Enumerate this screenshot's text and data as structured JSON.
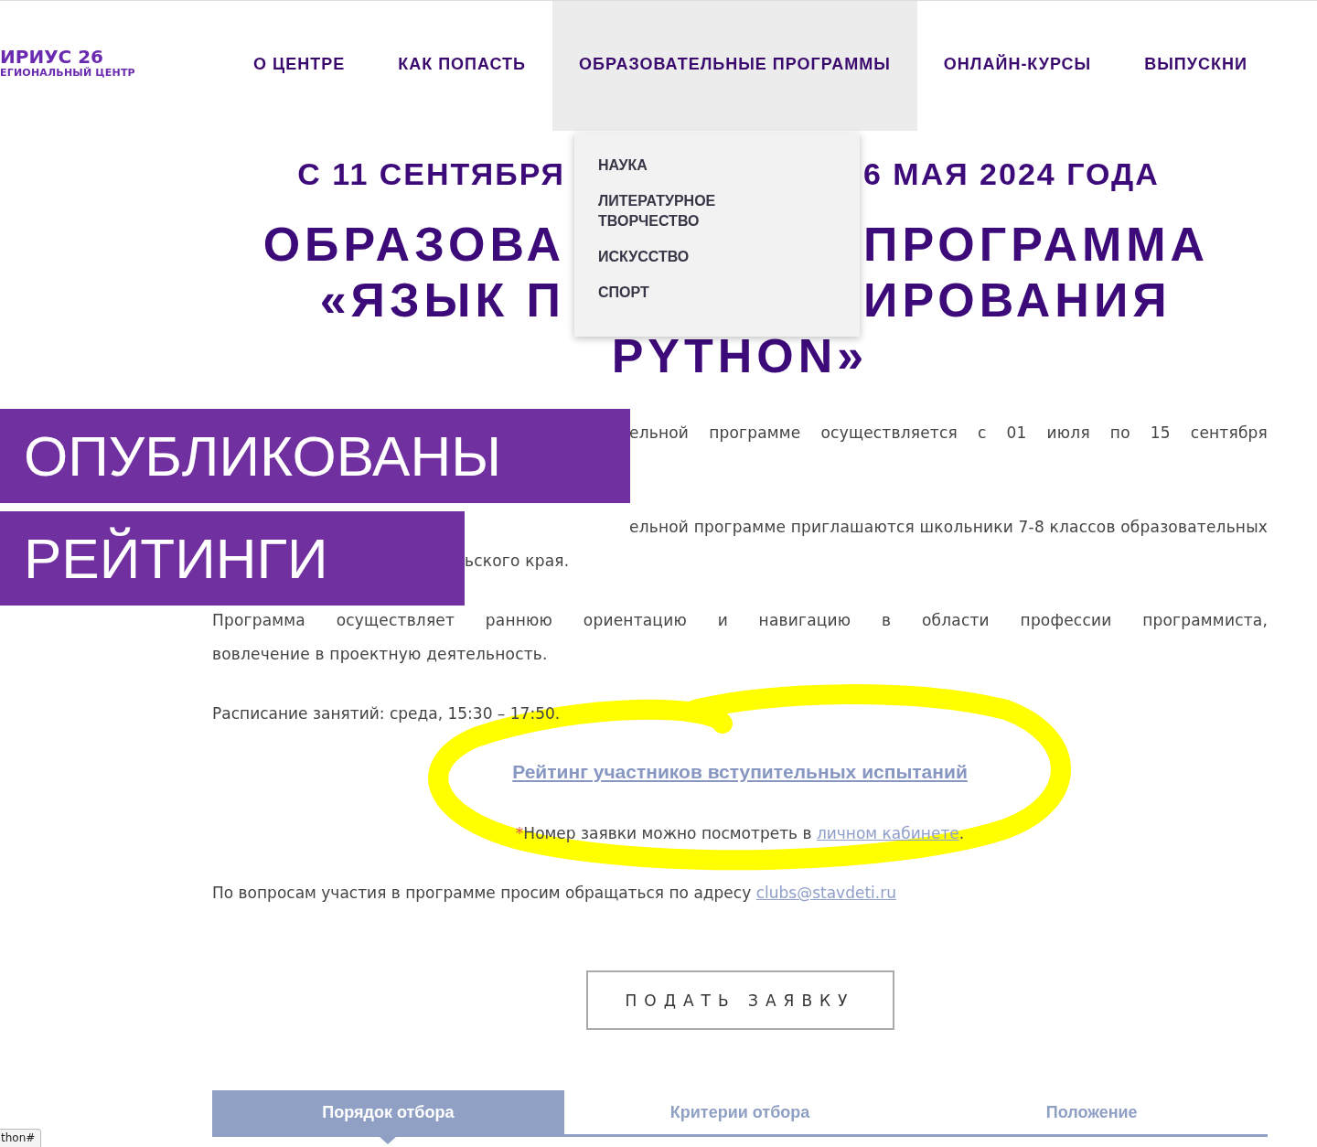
{
  "logo": {
    "title": "ИРИУС 26",
    "subtitle": "ЕГИОНАЛЬНЫЙ ЦЕНТР"
  },
  "nav": [
    {
      "label": "О ЦЕНТРЕ",
      "selected": false
    },
    {
      "label": "КАК ПОПАСТЬ",
      "selected": false
    },
    {
      "label": "ОБРАЗОВАТЕЛЬНЫЕ ПРОГРАММЫ",
      "selected": true
    },
    {
      "label": "ОНЛАЙН-КУРСЫ",
      "selected": false
    },
    {
      "label": "ВЫПУСКНИ",
      "selected": false
    }
  ],
  "dropdown": {
    "items": [
      "НАУКА",
      "ЛИТЕРАТУРНОЕ ТВОРЧЕСТВО",
      "ИСКУССТВО",
      "СПОРТ"
    ]
  },
  "dates": {
    "left": "С 11 СЕНТЯБРЯ",
    "right": "6 МАЯ 2024 ГОДА"
  },
  "title_lines": [
    {
      "kind": "split",
      "left": "ОБРАЗОВА",
      "right": "ПРОГРАММА"
    },
    {
      "kind": "split",
      "left": "«ЯЗЫК П",
      "right": "ИРОВАНИЯ"
    },
    {
      "kind": "whole",
      "text": "PYTHON»"
    }
  ],
  "paragraphs": [
    {
      "lines": [
        {
          "text": "ельной программе осуществляется с 01 июля по 15 сентября",
          "kind": "after_first_banner"
        }
      ]
    },
    {
      "lines": [
        {
          "text": "ельной программе приглашаются школьники 7-8 классов образовательных",
          "kind": "after_first_banner"
        },
        {
          "text": "ьского края.",
          "kind": "after_second_banner"
        }
      ]
    },
    {
      "lines": [
        {
          "text": "Программа осуществляет раннюю ориентацию и навигацию в области профессии программиста,",
          "kind": "justified"
        },
        {
          "text": "вовлечение в проектную деятельность.",
          "kind": "full"
        }
      ]
    }
  ],
  "schedule": "Расписание занятий: среда, 15:30 – 17:50.",
  "rating_link": "Рейтинг участников вступительных испытаний",
  "note": {
    "asterisk": "*",
    "text": "Номер заявки можно посмотреть в ",
    "link": "личном кабинете",
    "end": "."
  },
  "contact": {
    "text": "По вопросам участия в программе просим обращаться по адресу ",
    "link": "clubs@stavdeti.ru"
  },
  "apply_button": "ПОДАТЬ ЗАЯВКУ",
  "tabs": [
    {
      "label": "Порядок отбора",
      "selected": true
    },
    {
      "label": "Критерии отбора",
      "selected": false
    },
    {
      "label": "Положение",
      "selected": false
    }
  ],
  "banners": [
    "ОПУБЛИКОВАНЫ",
    "РЕЙТИНГИ"
  ],
  "status_url": "thon#"
}
